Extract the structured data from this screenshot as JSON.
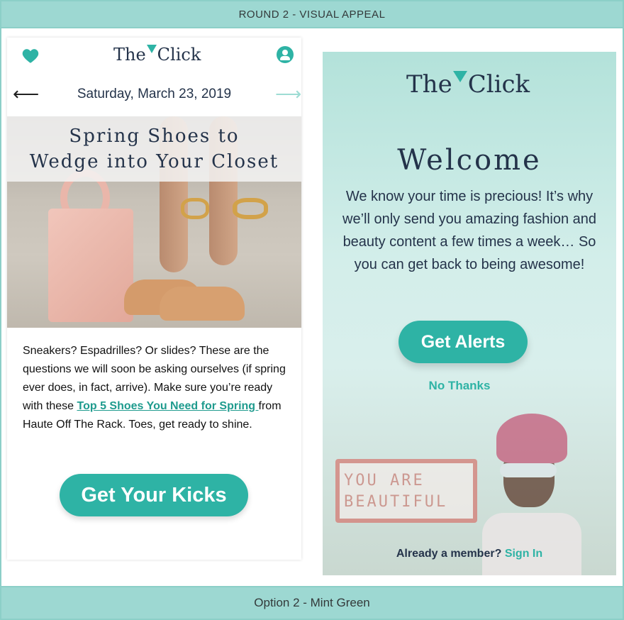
{
  "header": {
    "round_label": "ROUND 2 - VISUAL APPEAL"
  },
  "footer": {
    "option_label": "Option 2 - Mint Green"
  },
  "left_phone": {
    "logo_left": "The",
    "logo_right": "Click",
    "date": "Saturday, March 23, 2019",
    "hero_title_line1": "Spring Shoes to",
    "hero_title_line2": "Wedge into Your Closet",
    "article_before": "Sneakers? Espadrilles? Or slides? These are the questions we will soon be asking ourselves (if spring ever does, in fact, arrive). Make sure you’re ready with these ",
    "article_link": "Top 5 Shoes You Need for Spring ",
    "article_after": "from Haute Off The Rack. Toes, get ready to shine.",
    "cta_label": "Get Your Kicks",
    "arrow_left": "⟵",
    "arrow_right": "⟶"
  },
  "right_panel": {
    "logo_left": "The",
    "logo_right": "Click",
    "welcome": "Welcome",
    "intro": "We know your time is precious! It’s why we’ll only send you amazing fashion and beauty content a few times a week… So you can get back to being awesome!",
    "cta_label": "Get Alerts",
    "no_thanks": "No Thanks",
    "sign_line1": "YOU ARE",
    "sign_line2": "BEAUTIFUL",
    "already_member": "Already a member?",
    "sign_in": "Sign In"
  },
  "colors": {
    "accent": "#2eb3a5",
    "navy": "#24334a",
    "band": "#9dd8d2"
  },
  "icons": [
    "heart-icon",
    "user-icon",
    "arrow-left-icon",
    "arrow-right-icon",
    "logo-flag-icon"
  ]
}
